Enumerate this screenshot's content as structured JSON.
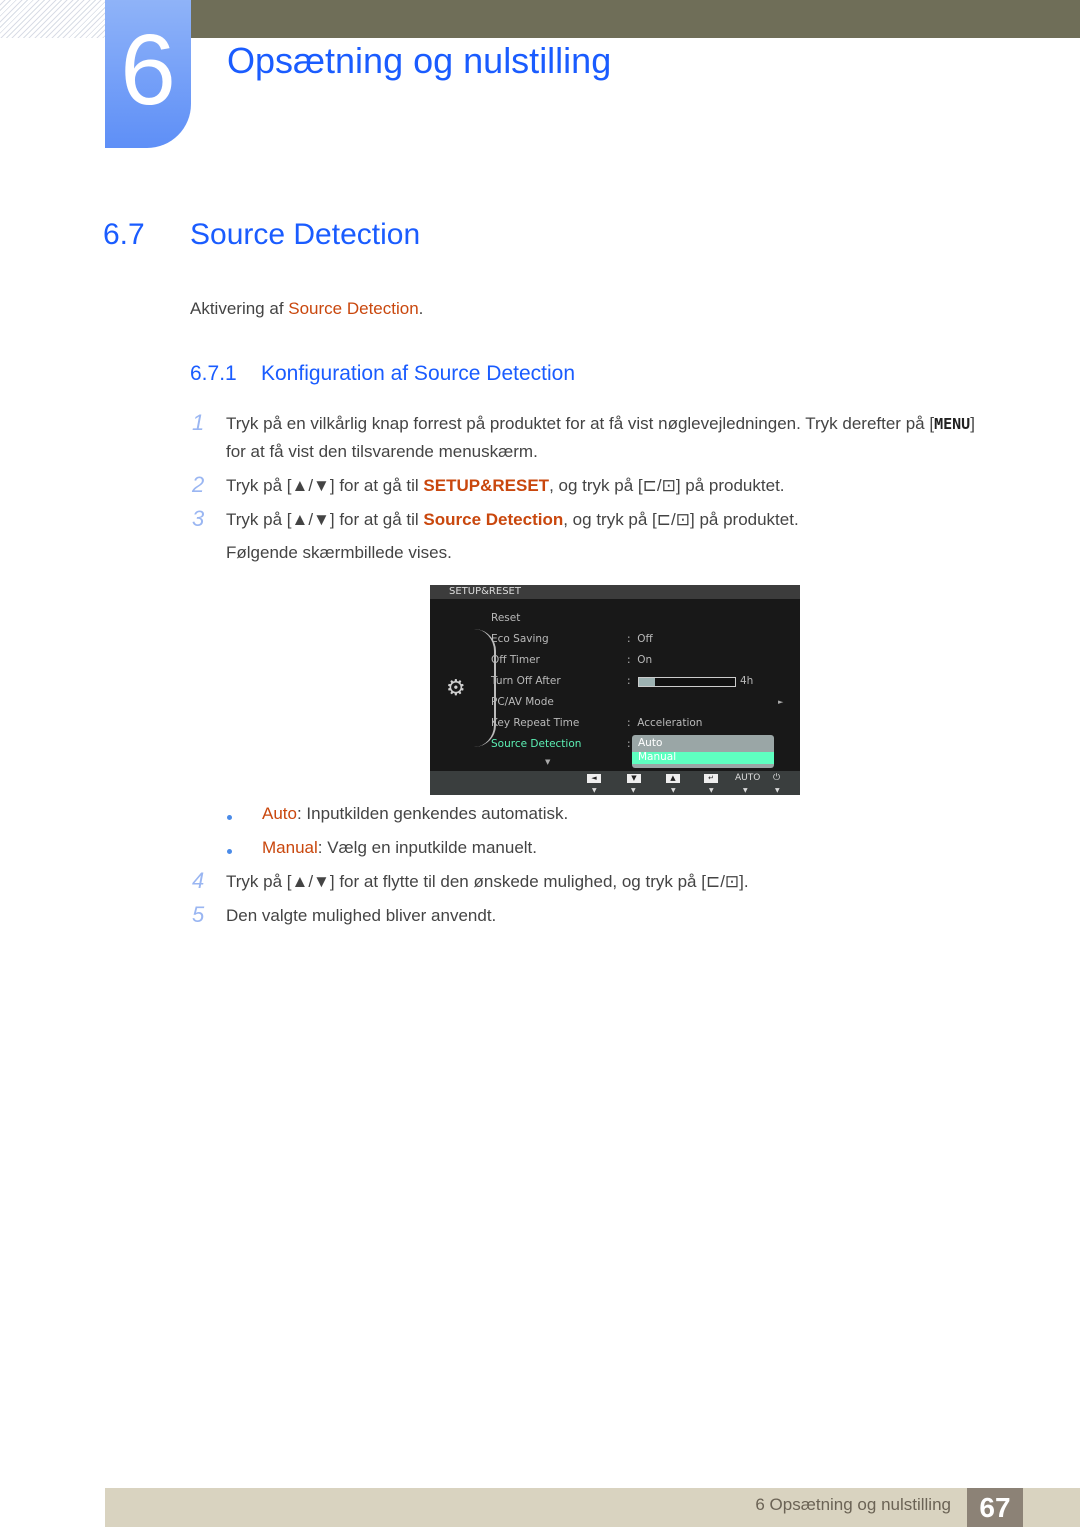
{
  "chapter": {
    "number": "6",
    "title": "Opsætning og nulstilling"
  },
  "section": {
    "number": "6.7",
    "title": "Source Detection"
  },
  "intro": {
    "prefix": "Aktivering af ",
    "highlight": "Source Detection",
    "suffix": "."
  },
  "subsection": {
    "number": "6.7.1",
    "title": "Konfiguration af Source Detection"
  },
  "steps": [
    {
      "num": "1",
      "line1": "Tryk på en vilkårlig knap forrest på produktet for at få vist nøglevejledningen. Tryk derefter på [",
      "key": "MENU",
      "line1_end": "]",
      "line2": "for at få vist den tilsvarende menuskærm."
    },
    {
      "num": "2",
      "pre": "Tryk på [▲/▼] for at gå til ",
      "highlight": "SETUP&RESET",
      "post": ", og tryk på [",
      "post2": "] på produktet."
    },
    {
      "num": "3",
      "pre": "Tryk på [▲/▼] for at gå til ",
      "highlight": "Source Detection",
      "post": ", og tryk på [",
      "post2": "] på produktet.",
      "after": "Følgende skærmbillede vises."
    },
    {
      "num": "4",
      "pre": "Tryk på [▲/▼] for at flytte til den ønskede mulighed, og tryk på [",
      "post2": "]."
    },
    {
      "num": "5",
      "text": "Den valgte mulighed bliver anvendt."
    }
  ],
  "bullets": [
    {
      "term": "Auto",
      "desc": ": Inputkilden genkendes automatisk."
    },
    {
      "term": "Manual",
      "desc": ": Vælg en inputkilde manuelt."
    }
  ],
  "osd": {
    "title": "SETUP&RESET",
    "items": [
      {
        "label": "Reset",
        "value": ""
      },
      {
        "label": "Eco Saving",
        "value": "Off"
      },
      {
        "label": "Off Timer",
        "value": "On"
      },
      {
        "label": "Turn Off After",
        "value": "4h",
        "bar_fraction": 0.17
      },
      {
        "label": "PC/AV Mode",
        "value": ""
      },
      {
        "label": "Key Repeat Time",
        "value": "Acceleration"
      },
      {
        "label": "Source Detection",
        "value": ""
      }
    ],
    "dropdown": {
      "options": [
        "Auto",
        "Manual"
      ],
      "highlighted": "Manual"
    },
    "buttons": [
      "◄",
      "▼",
      "▲",
      "↵",
      "AUTO",
      "⏻"
    ]
  },
  "footer": {
    "text": "6 Opsætning og nulstilling",
    "page": "67"
  },
  "icons": {
    "enter_source": "⊏/⊡",
    "up": "▲",
    "down": "▼"
  }
}
